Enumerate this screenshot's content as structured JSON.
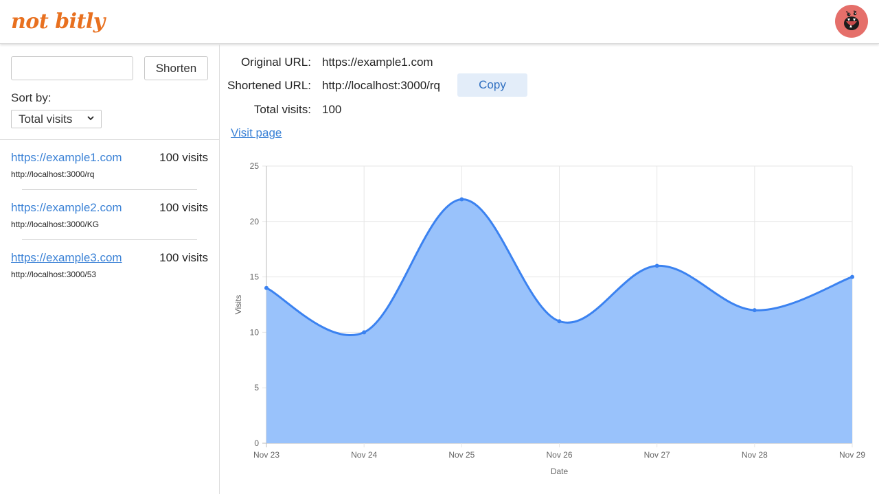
{
  "header": {
    "logo_text": "not bitly",
    "logo_color": "#e8701f",
    "avatar_icon": "monster-avatar-icon",
    "avatar_color": "#e56f6a"
  },
  "sidebar": {
    "url_input": {
      "value": "",
      "placeholder": ""
    },
    "shorten_label": "Shorten",
    "sort_label": "Sort by:",
    "sort_selected": "Total visits",
    "items": [
      {
        "original": "https://example1.com",
        "visits": "100 visits",
        "short": "http://localhost:3000/rq"
      },
      {
        "original": "https://example2.com",
        "visits": "100 visits",
        "short": "http://localhost:3000/KG"
      },
      {
        "original": "https://example3.com",
        "visits": "100 visits",
        "short": "http://localhost:3000/53"
      }
    ]
  },
  "detail": {
    "original_label": "Original URL:",
    "original_value": "https://example1.com",
    "shortened_label": "Shortened URL:",
    "shortened_value": "http://localhost:3000/rq",
    "copy_label": "Copy",
    "visits_label": "Total visits:",
    "visits_value": "100",
    "visit_page_label": "Visit page"
  },
  "chart_data": {
    "type": "area",
    "categories": [
      "Nov 23",
      "Nov 24",
      "Nov 25",
      "Nov 26",
      "Nov 27",
      "Nov 28",
      "Nov 29"
    ],
    "series": [
      {
        "values": [
          14,
          10,
          22,
          11,
          16,
          12,
          15
        ]
      }
    ],
    "xlabel": "Date",
    "ylabel": "Visits",
    "ylim": [
      0,
      25
    ],
    "yticks": [
      0,
      5,
      10,
      15,
      20,
      25
    ],
    "grid": true,
    "line_color": "#3b82f0",
    "fill_color": "#99c2fb"
  }
}
